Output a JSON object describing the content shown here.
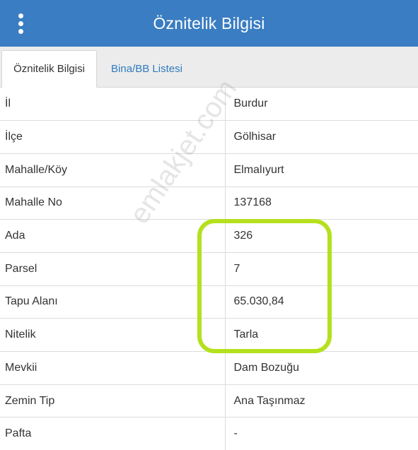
{
  "header": {
    "title": "Öznitelik Bilgisi",
    "menu_icon": "vertical-dots-icon"
  },
  "tabs": [
    {
      "label": "Öznitelik Bilgisi",
      "active": true
    },
    {
      "label": "Bina/BB Listesi",
      "active": false
    }
  ],
  "rows": [
    {
      "label": "İl",
      "value": "Burdur"
    },
    {
      "label": "İlçe",
      "value": "Gölhisar"
    },
    {
      "label": "Mahalle/Köy",
      "value": "Elmalıyurt"
    },
    {
      "label": "Mahalle No",
      "value": "137168"
    },
    {
      "label": "Ada",
      "value": "326"
    },
    {
      "label": "Parsel",
      "value": "7"
    },
    {
      "label": "Tapu Alanı",
      "value": "65.030,84"
    },
    {
      "label": "Nitelik",
      "value": "Tarla"
    },
    {
      "label": "Mevkii",
      "value": "Dam Bozuğu"
    },
    {
      "label": "Zemin Tip",
      "value": "Ana Taşınmaz"
    },
    {
      "label": "Pafta",
      "value": "-"
    }
  ],
  "watermark": "emlakjet.com",
  "colors": {
    "header_bg": "#3a7dc2",
    "tab_link": "#2f7bc0",
    "highlight": "#b5e01e"
  }
}
